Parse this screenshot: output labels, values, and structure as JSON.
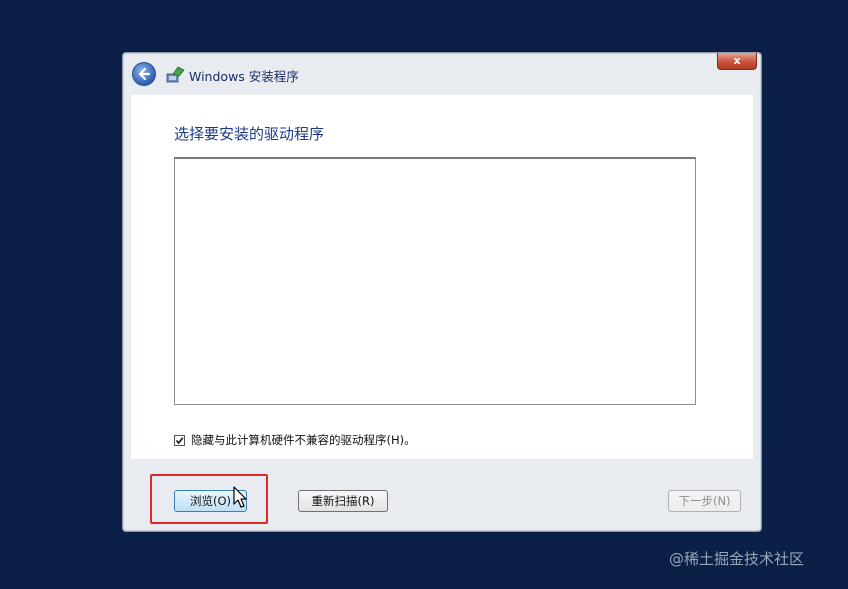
{
  "window": {
    "title": "Windows 安装程序",
    "close_label": "x"
  },
  "page": {
    "title": "选择要安装的驱动程序"
  },
  "options": {
    "hide_incompatible_label": "隐藏与此计算机硬件不兼容的驱动程序(H)。",
    "hide_incompatible_checked": true
  },
  "buttons": {
    "browse_label": "浏览(O)",
    "rescan_label": "重新扫描(R)",
    "next_label": "下一步(N)"
  },
  "watermark": "@稀土掘金技术社区",
  "colors": {
    "desktop": "#0b1f47",
    "highlight": "#e02a2a",
    "title_text": "#1e3a8a"
  }
}
